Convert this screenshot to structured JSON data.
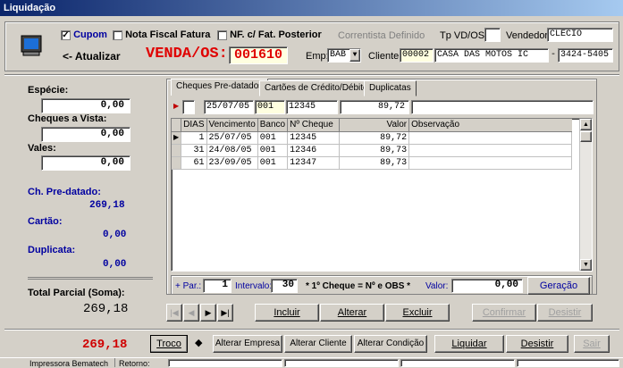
{
  "window": {
    "title": "Liquidação"
  },
  "top": {
    "cupom_label": "Cupom",
    "cupom_checked": true,
    "nota_label": "Nota Fiscal Fatura",
    "nf_label": "NF. c/ Fat. Posterior",
    "correntista_label": "Correntista Definido",
    "tpvd_label": "Tp VD/OS:",
    "vendedor_label": "Vendedor:",
    "vendedor_value": "CLECIO",
    "atualizar_label": "<- Atualizar",
    "venda_label": "VENDA/OS:",
    "venda_value": "001610",
    "emp_label": "Emp:",
    "emp_value": "BAB",
    "cliente_label": "Cliente:",
    "cliente_code": "00002",
    "cliente_name": "CASA DAS MOTOS IC",
    "cliente_phone": "3424-5405"
  },
  "left": {
    "especie_label": "Espécie:",
    "especie_value": "0,00",
    "cheques_vista_label": "Cheques a Vista:",
    "cheques_vista_value": "0,00",
    "vales_label": "Vales:",
    "vales_value": "0,00",
    "ch_pre_label": "Ch. Pre-datado:",
    "ch_pre_value": "269,18",
    "cartao_label": "Cartão:",
    "cartao_value": "0,00",
    "duplicata_label": "Duplicata:",
    "duplicata_value": "0,00",
    "total_label": "Total Parcial (Soma):",
    "total_value": "269,18"
  },
  "tabs": [
    "Cheques Pre-datados",
    "Cartões de Crédito/Débito",
    "Duplicatas"
  ],
  "entry": {
    "vencimento": "25/07/05",
    "banco": "001",
    "cheque": "12345",
    "valor": "89,72"
  },
  "grid": {
    "headers": [
      "DIAS",
      "Vencimento",
      "Banco",
      "Nº Cheque",
      "Valor",
      "Observação"
    ],
    "rows": [
      {
        "dias": "1",
        "vencimento": "25/07/05",
        "banco": "001",
        "cheque": "12345",
        "valor": "89,72"
      },
      {
        "dias": "31",
        "vencimento": "24/08/05",
        "banco": "001",
        "cheque": "12346",
        "valor": "89,73"
      },
      {
        "dias": "61",
        "vencimento": "23/09/05",
        "banco": "001",
        "cheque": "12347",
        "valor": "89,73"
      }
    ]
  },
  "params": {
    "par_label": "+ Par.:",
    "par_value": "1",
    "intervalo_label": "Intervalo:",
    "intervalo_value": "30",
    "note": "* 1º Cheque = Nº e OBS *",
    "valor_label": "Valor:",
    "valor_value": "0,00",
    "geracao_label": "Geração"
  },
  "nav": {
    "incluir": "Incluir",
    "alterar": "Alterar",
    "excluir": "Excluir",
    "confirmar": "Confirmar",
    "desistir": "Desistir"
  },
  "bottom": {
    "total_value": "269,18",
    "troco": "Troco",
    "alterar_empresa": "Alterar Empresa",
    "alterar_cliente": "Alterar Cliente",
    "alterar_condicao": "Alterar Condição",
    "liquidar": "Liquidar",
    "desistir": "Desistir",
    "sair": "Sair"
  },
  "status": {
    "impressora": "Impressora Bematech",
    "retorno": "Retorno:"
  },
  "colors": {
    "title_start": "#0a246a",
    "venda_red": "#e00000",
    "value_blue": "#0000a0",
    "total_red": "#d00000"
  }
}
